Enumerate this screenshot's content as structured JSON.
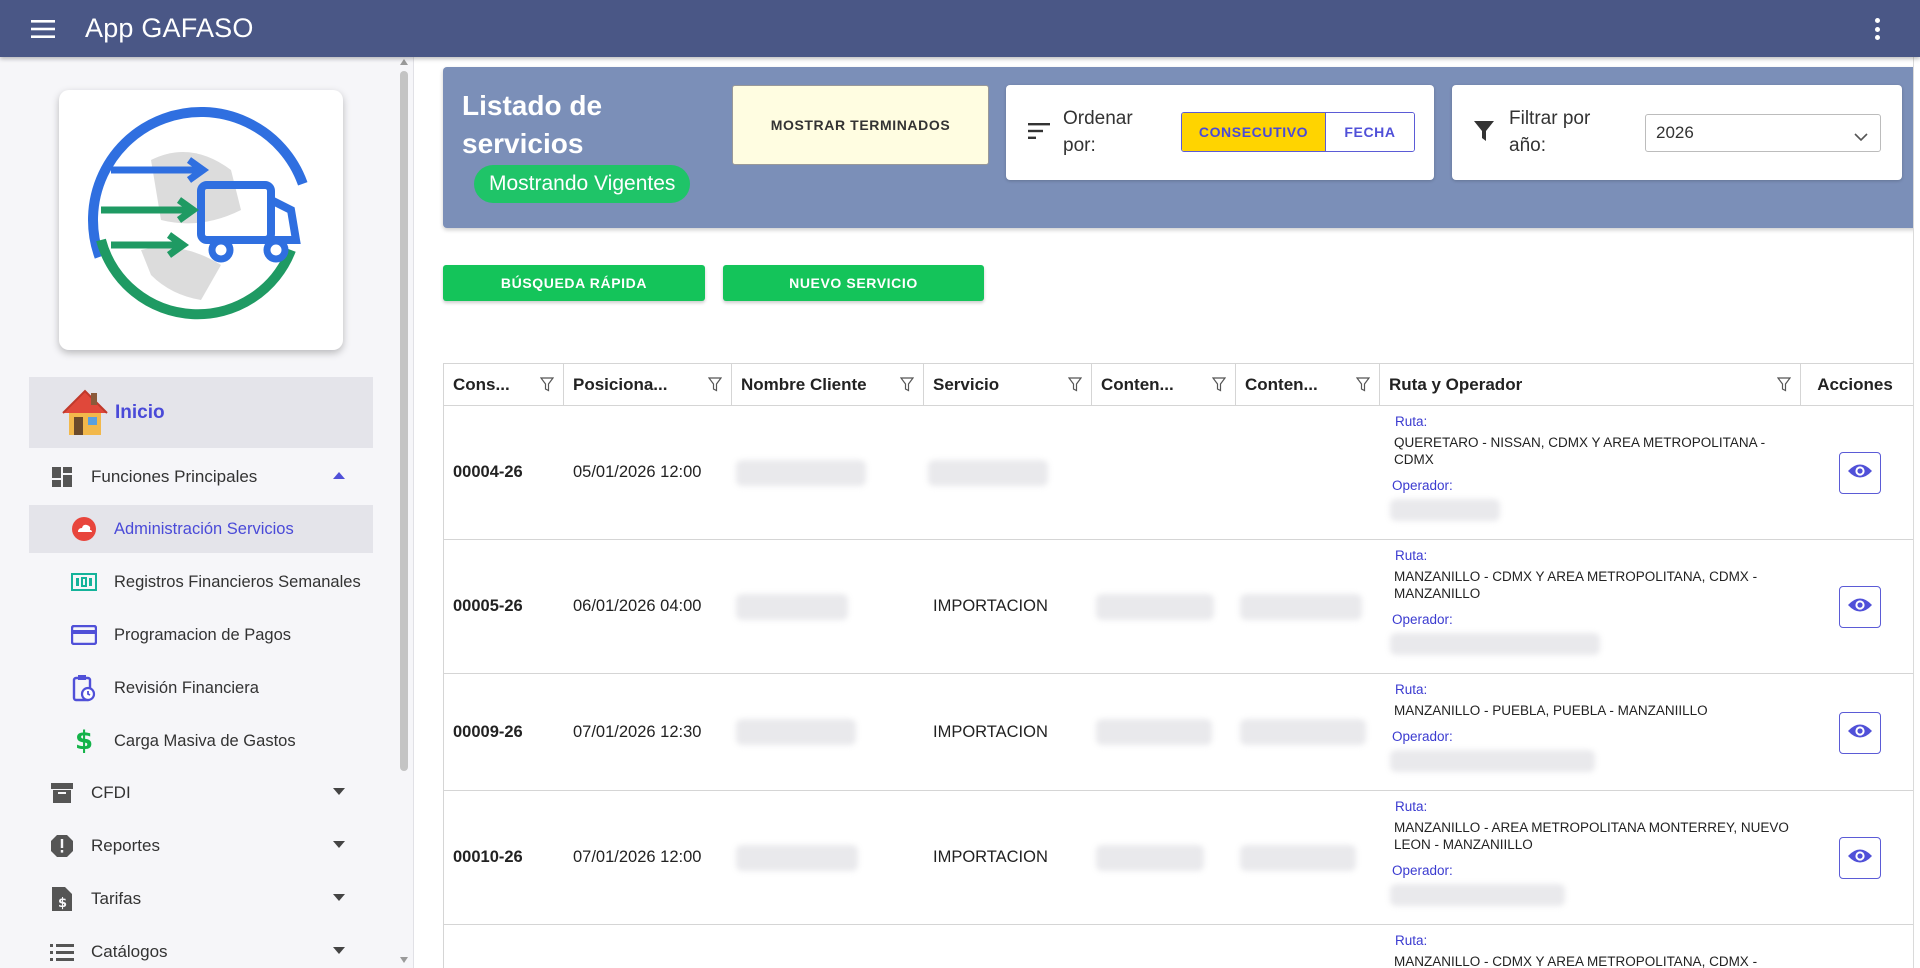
{
  "appbar": {
    "title": "App GAFASO"
  },
  "sidebar": {
    "home_label": "Inicio",
    "groups": [
      {
        "label": "Funciones Principales",
        "expanded": true
      },
      {
        "label": "CFDI",
        "expanded": false
      },
      {
        "label": "Reportes",
        "expanded": false
      },
      {
        "label": "Tarifas",
        "expanded": false
      },
      {
        "label": "Catálogos",
        "expanded": false
      }
    ],
    "sub_items": [
      {
        "label": "Administración Servicios",
        "active": true
      },
      {
        "label": "Registros Financieros Semanales",
        "active": false
      },
      {
        "label": "Programacion de Pagos",
        "active": false
      },
      {
        "label": "Revisión Financiera",
        "active": false
      },
      {
        "label": "Carga Masiva de Gastos",
        "active": false
      }
    ]
  },
  "header": {
    "title": "Listado de servicios",
    "status_pill": "Mostrando Vigentes",
    "toggle_terminados": "MOSTRAR TERMINADOS",
    "order_label": "Ordenar por:",
    "order_options": [
      "CONSECUTIVO",
      "FECHA"
    ],
    "order_selected": "CONSECUTIVO",
    "filter_label": "Filtrar por año:",
    "year_selected": "2026"
  },
  "actions": {
    "quick_search": "BÚSQUEDA RÁPIDA",
    "new_service": "NUEVO SERVICIO"
  },
  "table": {
    "columns": [
      "Cons...",
      "Posiciona...",
      "Nombre Cliente",
      "Servicio",
      "Conten...",
      "Conten...",
      "Ruta y Operador",
      "Acciones"
    ],
    "ruta_label": "Ruta:",
    "operador_label": "Operador:",
    "rows": [
      {
        "cons": "00004-26",
        "posicionamiento": "05/01/2026 12:00",
        "servicio": "",
        "ruta": "QUERETARO - NISSAN, CDMX Y AREA METROPOLITANA - CDMX"
      },
      {
        "cons": "00005-26",
        "posicionamiento": "06/01/2026 04:00",
        "servicio": "IMPORTACION",
        "ruta": "MANZANILLO - CDMX Y AREA METROPOLITANA, CDMX - MANZANILLO"
      },
      {
        "cons": "00009-26",
        "posicionamiento": "07/01/2026 12:30",
        "servicio": "IMPORTACION",
        "ruta": "MANZANILLO - PUEBLA, PUEBLA - MANZANIILLO"
      },
      {
        "cons": "00010-26",
        "posicionamiento": "07/01/2026 12:00",
        "servicio": "IMPORTACION",
        "ruta": "MANZANILLO - AREA METROPOLITANA MONTERREY, NUEVO LEON - MANZANIILLO"
      },
      {
        "cons": "",
        "posicionamiento": "",
        "servicio": "",
        "ruta": "MANZANILLO - CDMX Y AREA METROPOLITANA, CDMX -"
      }
    ]
  },
  "colors": {
    "appbar": "#4a5786",
    "header_panel": "#7b8fb8",
    "accent": "#4a4ad8",
    "green": "#14c45a",
    "yellow": "#ffd400"
  }
}
